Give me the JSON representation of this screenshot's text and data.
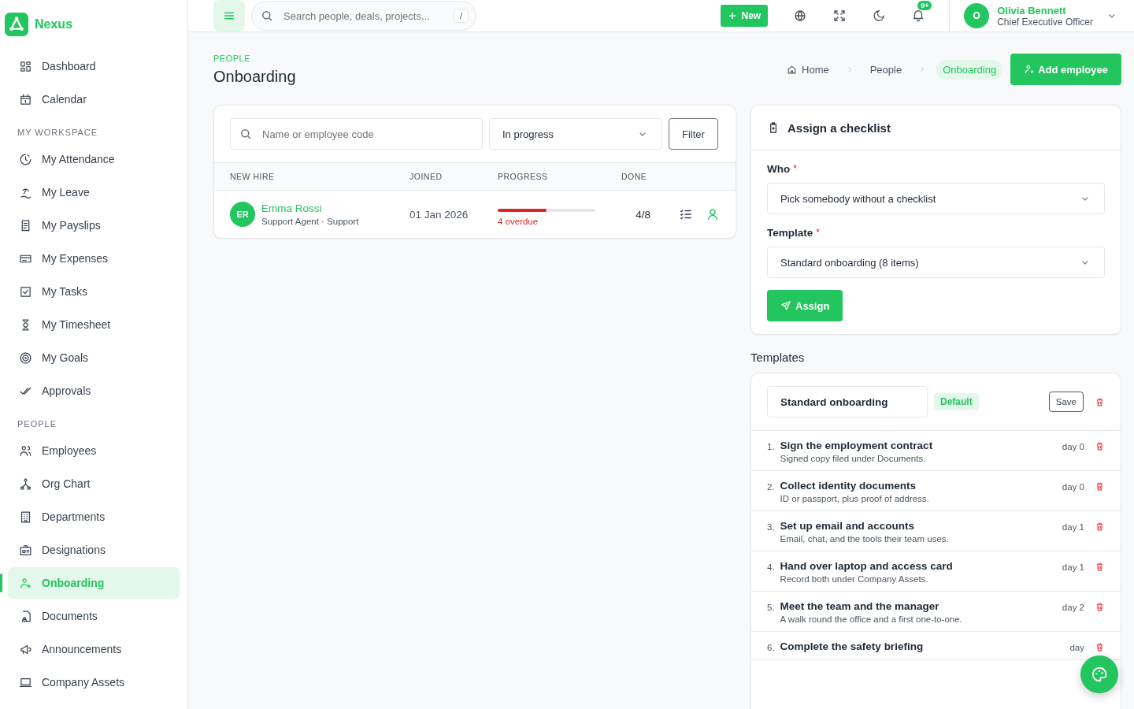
{
  "sidebar": {
    "logo": "Nexus",
    "groups": [
      {
        "items": [
          {
            "label": "Dashboard",
            "selected": false
          },
          {
            "label": "Calendar",
            "selected": false
          }
        ]
      },
      {
        "heading": "MY WORKSPACE",
        "items": [
          {
            "label": "My Attendance",
            "selected": false
          },
          {
            "label": "My Leave",
            "selected": false
          },
          {
            "label": "My Payslips",
            "selected": false
          },
          {
            "label": "My Expenses",
            "selected": false
          },
          {
            "label": "My Tasks",
            "selected": false
          },
          {
            "label": "My Timesheet",
            "selected": false
          },
          {
            "label": "My Goals",
            "selected": false
          },
          {
            "label": "Approvals",
            "selected": false
          }
        ]
      },
      {
        "heading": "PEOPLE",
        "items": [
          {
            "label": "Employees",
            "selected": false
          },
          {
            "label": "Org Chart",
            "selected": false
          },
          {
            "label": "Departments",
            "selected": false
          },
          {
            "label": "Designations",
            "selected": false
          },
          {
            "label": "Onboarding",
            "selected": true
          },
          {
            "label": "Documents",
            "selected": false
          },
          {
            "label": "Announcements",
            "selected": false
          },
          {
            "label": "Company Assets",
            "selected": false
          }
        ]
      }
    ]
  },
  "topbar": {
    "search": {
      "placeholder": "Search people, deals, projects...",
      "shortcut": "/"
    },
    "new_button": "New",
    "notifications_badge": "9+",
    "user": {
      "avatar": "O",
      "name": "Olivia Bennett",
      "role": "Chief Executive Officer"
    }
  },
  "page": {
    "eyebrow": "PEOPLE",
    "title": "Onboarding",
    "breadcrumb": [
      {
        "label": "Home",
        "selected": false
      },
      {
        "label": "People",
        "selected": false
      },
      {
        "label": "Onboarding",
        "selected": true
      }
    ],
    "add_button": "Add employee"
  },
  "hires": {
    "search": {
      "placeholder": "Name or employee code"
    },
    "status_filter": "In progress",
    "filter_button": "Filter",
    "table": {
      "columns": [
        "NEW HIRE",
        "JOINED",
        "PROGRESS",
        "DONE"
      ],
      "rows": [
        {
          "initials": "ER",
          "name": "Emma Rossi",
          "subtitle": "Support Agent · Support",
          "joined": "01 Jan 2026",
          "level": 0.5,
          "overdue": "4 overdue",
          "done": "4/8"
        }
      ]
    }
  },
  "assign": {
    "title": "Assign a checklist",
    "fields": [
      {
        "label": "Who",
        "required_mark": "*",
        "value": "Pick somebody without a checklist"
      },
      {
        "label": "Template",
        "required_mark": "*",
        "value": "Standard onboarding (8 items)"
      }
    ],
    "button": "Assign"
  },
  "templates": {
    "title": "Templates",
    "name": "Standard onboarding",
    "badge": "Default",
    "save_button": "Save",
    "items": [
      {
        "number": "1.",
        "title": "Sign the employment contract",
        "description": "Signed copy filed under Documents.",
        "day": "day 0"
      },
      {
        "number": "2.",
        "title": "Collect identity documents",
        "description": "ID or passport, plus proof of address.",
        "day": "day 0"
      },
      {
        "number": "3.",
        "title": "Set up email and accounts",
        "description": "Email, chat, and the tools their team uses.",
        "day": "day 1"
      },
      {
        "number": "4.",
        "title": "Hand over laptop and access card",
        "description": "Record both under Company Assets.",
        "day": "day 1"
      },
      {
        "number": "5.",
        "title": "Meet the team and the manager",
        "description": "A walk round the office and a first one-to-one.",
        "day": "day 2"
      },
      {
        "number": "6.",
        "title": "Complete the safety briefing",
        "day": "day"
      }
    ]
  }
}
